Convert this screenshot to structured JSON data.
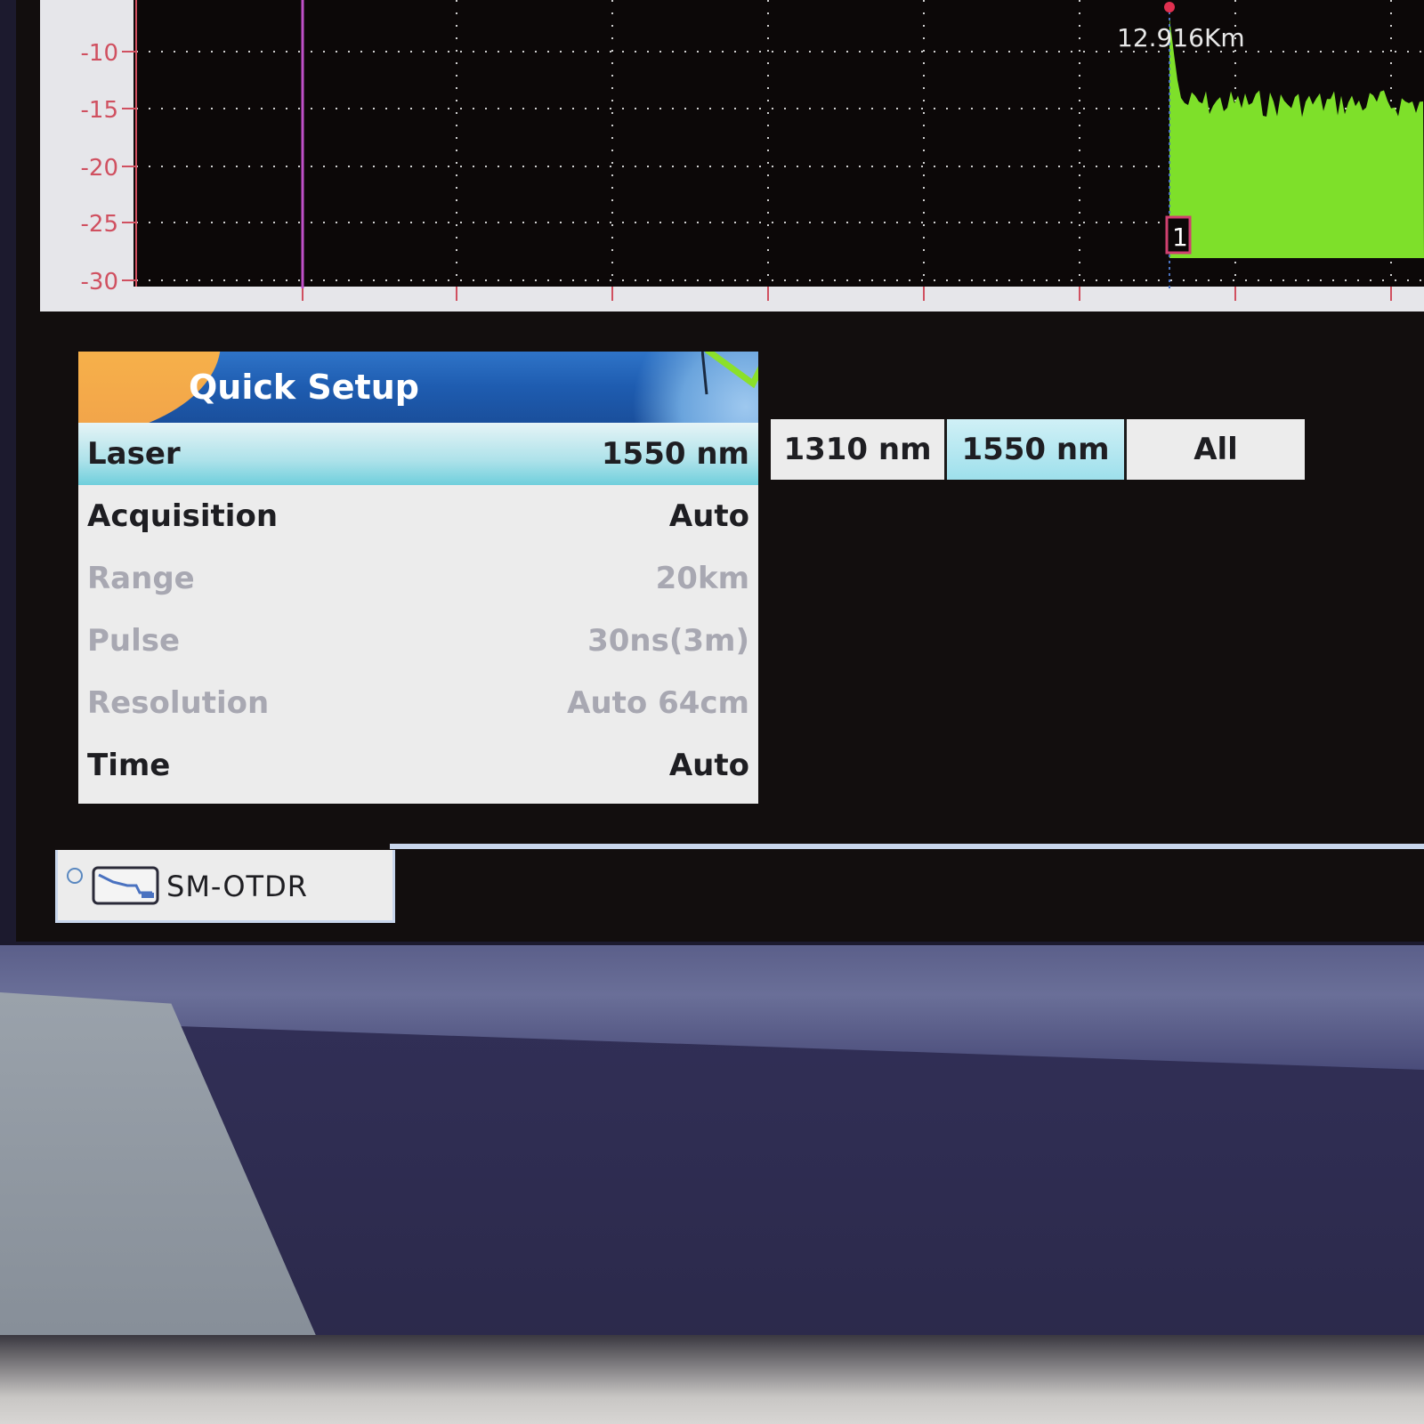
{
  "chart": {
    "y_ticks": [
      "-10",
      "-15",
      "-20",
      "-25",
      "-30"
    ],
    "marker_distance": "12.916Km",
    "event_marker": "1",
    "colors": {
      "trace": "#7ee02a",
      "ytick": "#d05060",
      "cursor": "#c050c8",
      "marker": "#e03050"
    }
  },
  "quick_setup": {
    "title": "Quick Setup",
    "rows": [
      {
        "label": "Laser",
        "value": "1550 nm",
        "state": "selected"
      },
      {
        "label": "Acquisition",
        "value": "Auto",
        "state": "enabled"
      },
      {
        "label": "Range",
        "value": "20km",
        "state": "disabled"
      },
      {
        "label": "Pulse",
        "value": "30ns(3m)",
        "state": "disabled"
      },
      {
        "label": "Resolution",
        "value": "Auto 64cm",
        "state": "disabled"
      },
      {
        "label": "Time",
        "value": "Auto",
        "state": "enabled"
      }
    ]
  },
  "laser_options": [
    {
      "label": "1310 nm",
      "active": false
    },
    {
      "label": "1550 nm",
      "active": true
    },
    {
      "label": "All",
      "active": false
    }
  ],
  "tabs": [
    {
      "label": "SM-OTDR",
      "icon": "otdr-trace-icon"
    }
  ]
}
